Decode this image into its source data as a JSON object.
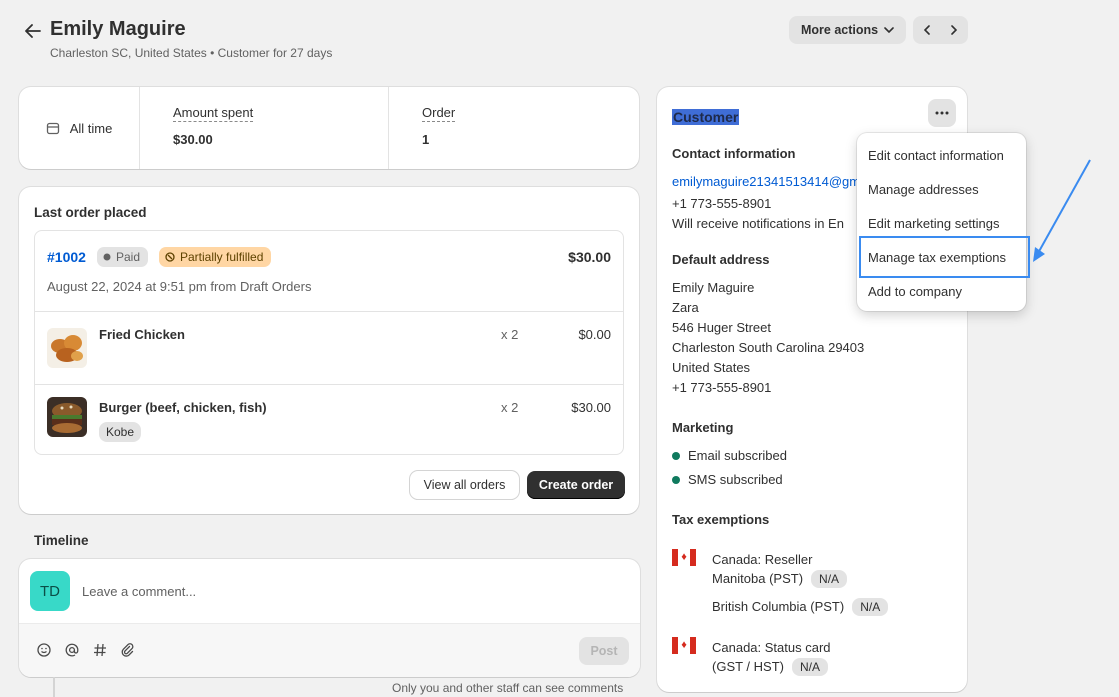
{
  "header": {
    "title": "Emily Maguire",
    "subtitle": "Charleston SC, United States • Customer for 27 days",
    "more_actions": "More actions"
  },
  "stats": {
    "period": "All time",
    "amount_label": "Amount spent",
    "amount_value": "$30.00",
    "order_label": "Order",
    "order_value": "1"
  },
  "last_order": {
    "title": "Last order placed",
    "number": "#1002",
    "payment_badge": "Paid",
    "fulfillment_badge": "Partially fulfilled",
    "total": "$30.00",
    "date": "August 22, 2024 at 9:51 pm from Draft Orders",
    "items": [
      {
        "name": "Fried Chicken",
        "qty": "x 2",
        "price": "$0.00"
      },
      {
        "name": "Burger (beef, chicken, fish)",
        "qty": "x 2",
        "price": "$30.00",
        "variant": "Kobe"
      }
    ],
    "view_all_label": "View all orders",
    "create_label": "Create order"
  },
  "timeline": {
    "title": "Timeline",
    "avatar_initials": "TD",
    "placeholder": "Leave a comment...",
    "post_label": "Post",
    "staff_note": "Only you and other staff can see comments"
  },
  "customer": {
    "title": "Customer",
    "contact_title": "Contact information",
    "email": "emilymaguire21341513414@gm",
    "phone": "+1 773-555-8901",
    "notifications": "Will receive notifications in En",
    "address_title": "Default address",
    "address_lines": [
      "Emily Maguire",
      "Zara",
      "546 Huger Street",
      "Charleston South Carolina 29403",
      "United States",
      "+1 773-555-8901"
    ],
    "marketing_title": "Marketing",
    "email_subscribed": "Email subscribed",
    "sms_subscribed": "SMS subscribed",
    "tax_title": "Tax exemptions",
    "tax": {
      "reseller": "Canada: Reseller",
      "manitoba": "Manitoba (PST)",
      "bc": "British Columbia (PST)",
      "status_card": "Canada: Status card",
      "gst_hst": "(GST / HST)",
      "na": "N/A"
    }
  },
  "menu": {
    "items": [
      "Edit contact information",
      "Manage addresses",
      "Edit marketing settings",
      "Manage tax exemptions",
      "Add to company"
    ]
  },
  "colors": {
    "accent_link": "#005bd3",
    "highlight": "#3a8bf0",
    "badge_partial": "#ffd6a4",
    "subscribed_dot": "#0f7a5e"
  }
}
